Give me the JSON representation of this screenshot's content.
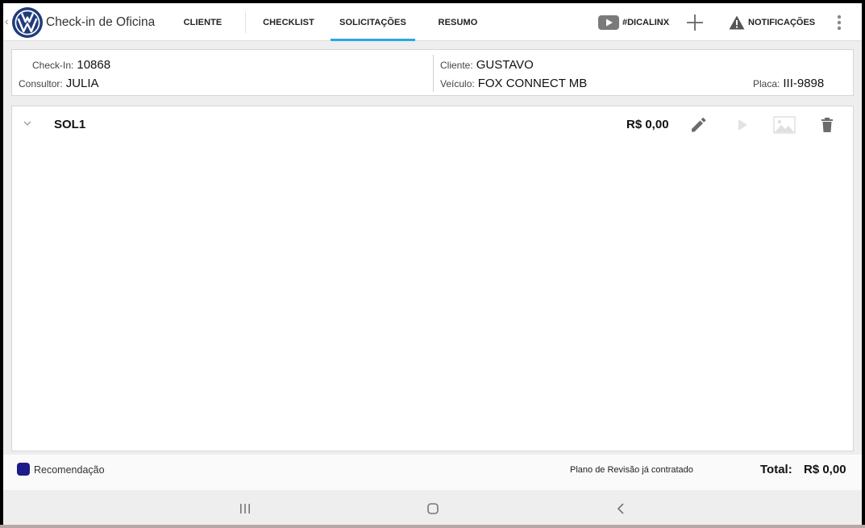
{
  "app": {
    "title": "Check-in de Oficina"
  },
  "tabs": [
    {
      "label": "CLIENTE",
      "active": false
    },
    {
      "label": "CHECKLIST",
      "active": false
    },
    {
      "label": "SOLICITAÇÕES",
      "active": true
    },
    {
      "label": "RESUMO",
      "active": false
    }
  ],
  "toolbar": {
    "dica_label": "#DICALINX",
    "notifications_label": "NOTIFICAÇÕES"
  },
  "info": {
    "checkin_label": "Check-In:",
    "checkin_value": "10868",
    "consultor_label": "Consultor:",
    "consultor_value": "JULIA",
    "cliente_label": "Cliente:",
    "cliente_value": "GUSTAVO",
    "veiculo_label": "Veículo:",
    "veiculo_value": "FOX CONNECT MB",
    "placa_label": "Placa:",
    "placa_value": "III-9898"
  },
  "solicitation": {
    "title": "SOL1",
    "price": "R$ 0,00"
  },
  "footer": {
    "legend_label": "Recomendação",
    "plano_text": "Plano de Revisão já contratado",
    "total_label": "Total:",
    "total_value": "R$ 0,00"
  },
  "colors": {
    "accent": "#29a8e0",
    "legend": "#1d1a8a",
    "vw_blue": "#1f3b7a"
  }
}
